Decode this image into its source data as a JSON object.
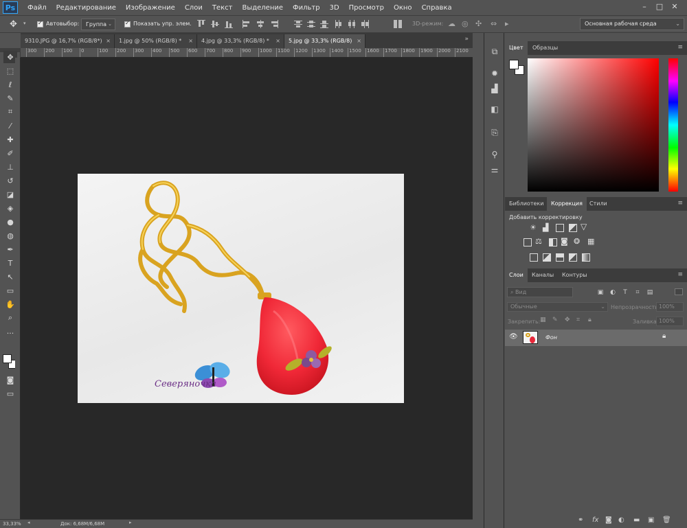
{
  "menubar": {
    "app_badge": "Ps",
    "items": [
      "Файл",
      "Редактирование",
      "Изображение",
      "Слои",
      "Текст",
      "Выделение",
      "Фильтр",
      "3D",
      "Просмотр",
      "Окно",
      "Справка"
    ]
  },
  "options": {
    "autoselect_label": "Автовыбор:",
    "autoselect_value": "Группа",
    "show_controls_label": "Показать упр. элем.",
    "mode_3d_label": "3D-режим:"
  },
  "workspace_select": "Основная рабочая среда",
  "tabs": [
    {
      "label": "9310.JPG @ 16,7% (RGB/8*)"
    },
    {
      "label": "1.jpg @ 50% (RGB/8) *"
    },
    {
      "label": "4.jpg @ 33,3% (RGB/8) *"
    },
    {
      "label": "5.jpg @ 33,3% (RGB/8)"
    }
  ],
  "ruler_top": [
    "300",
    "200",
    "100",
    "0",
    "100",
    "200",
    "300",
    "400",
    "500",
    "600",
    "700",
    "800",
    "900",
    "1000",
    "1100",
    "1200",
    "1300",
    "1400",
    "1500",
    "1600",
    "1700",
    "1800",
    "1900",
    "2000",
    "2100"
  ],
  "image": {
    "watermark": "Северяночка"
  },
  "status": {
    "zoom": "33,33%",
    "doc": "Док: 6,68M/6,68M"
  },
  "panels": {
    "color_tabs": [
      "Цвет",
      "Образцы"
    ],
    "adjust_tabs": [
      "Библиотеки",
      "Коррекция",
      "Стили"
    ],
    "adjust_title": "Добавить корректировку",
    "layers_tabs": [
      "Слои",
      "Каналы",
      "Контуры"
    ],
    "layers_search": "Вид",
    "blend_mode": "Обычные",
    "opacity_label": "Непрозрачность:",
    "opacity_value": "100%",
    "lock_label": "Закрепить:",
    "fill_label": "Заливка:",
    "fill_value": "100%",
    "layer_name": "Фон"
  },
  "colors": {
    "accent": "#31a8ff",
    "pendant": "#f0283a",
    "chain": "#d9a320"
  }
}
